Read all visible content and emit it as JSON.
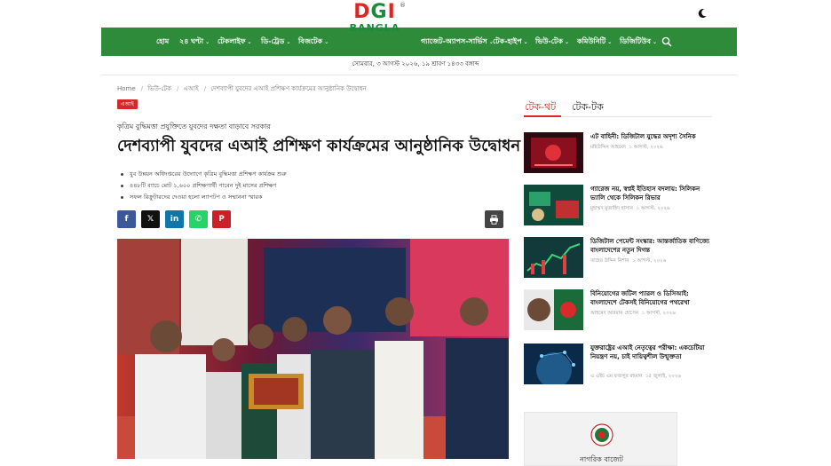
{
  "header": {
    "logo_text": "DGI",
    "logo_sub": "BANGLA",
    "dark_mode_icon": "moon-icon"
  },
  "nav": {
    "items": [
      {
        "label": "হোম",
        "has_dropdown": false
      },
      {
        "label": "২৪ ঘণ্টা",
        "has_dropdown": true
      },
      {
        "label": "টেকলাইফ",
        "has_dropdown": true
      },
      {
        "label": "ডি-ট্রেড",
        "has_dropdown": true
      },
      {
        "label": "বিজটেক",
        "has_dropdown": true
      },
      {
        "label": "গ্যাজেট-অ্যাপস-সার্ভিস",
        "has_dropdown": true
      },
      {
        "label": "টেক-হাইপ",
        "has_dropdown": true
      },
      {
        "label": "ভিউ-টেক",
        "has_dropdown": true
      },
      {
        "label": "কমিউনিটি",
        "has_dropdown": true
      },
      {
        "label": "ডিজিটিউব",
        "has_dropdown": true
      }
    ],
    "search_icon": "search-icon",
    "color": "#2e8b3a"
  },
  "dateline": "সোমবার, ৩ আগস্ট ২০২৬, ১৯ শ্রাবণ ১৪৩৩ বঙ্গাব্দ",
  "breadcrumb": [
    "Home",
    "ভিউ-টেক",
    "এআই",
    "দেশব্যাপী যুবদের এআই প্রশিক্ষণ কার্যক্রমের আনুষ্ঠানিক উদ্বোধন"
  ],
  "article": {
    "category_tag": "এআই",
    "kicker": "কৃত্রিম বুদ্ধিমত্তা প্রযুক্তিতে যুবদের দক্ষতা বাড়াবে সরকার",
    "headline": "দেশব্যাপী যুবদের এআই প্রশিক্ষণ কার্যক্রমের আনুষ্ঠানিক উদ্বোধন",
    "bullets": [
      "যুব উন্নয়ন অধিদপ্তরের উদ্যোগে কৃত্রিম বুদ্ধিমত্তা প্রশিক্ষণ কার্যক্রম শুরু",
      "৪৪৮টি ব্যাচে মোট ১,৬০০ প্রশিক্ষণার্থী পাবেন দুই মাসের প্রশিক্ষণ",
      "সফল রিক্রুটারদের দেওয়া হলো ল্যাপটপ ও সম্মাননা স্মারক"
    ],
    "share": [
      {
        "name": "facebook",
        "glyph": "f",
        "color": "#3b5998"
      },
      {
        "name": "x",
        "glyph": "𝕏",
        "color": "#111111"
      },
      {
        "name": "linkedin",
        "glyph": "in",
        "color": "#0e76a8"
      },
      {
        "name": "whatsapp",
        "glyph": "✆",
        "color": "#25d366"
      },
      {
        "name": "pinterest",
        "glyph": "P",
        "color": "#cb2027"
      }
    ],
    "print_icon": "printer-icon",
    "hero_image": "photo-award-ceremony"
  },
  "sidebar": {
    "tabs": [
      {
        "label": "টেক-থট",
        "active": true
      },
      {
        "label": "টেক-টক",
        "active": false
      }
    ],
    "items": [
      {
        "title": "এট বাহিনী: ডিজিটাল যুদ্ধের অদৃশ্য সৈনিক",
        "author": "মহিউদ্দিন আহমেদ",
        "date": "১ আগস্ট, ২০২৬",
        "thumb": "red-digital"
      },
      {
        "title": "গ্যারেজ নয়, স্বপ্নই ইতিহাস বদলায়: সিলিকন ভ্যালি থেকে সিলিকন রিভার",
        "author": "মুহাম্মদ মুজাহিদ হাসান",
        "date": "১ আগস্ট, ২০২৬",
        "thumb": "green-circuit"
      },
      {
        "title": "ডিজিটাল পেমেন্ট সংস্কার: আন্তর্জাতিক বাণিজ্যে বাংলাদেশের নতুন দিগন্ত",
        "author": "তাহের উদ্দিন নিশান",
        "date": "১ আগস্ট, ২০২৬",
        "thumb": "payment-chart"
      },
      {
        "title": "বিনিয়োগের জটিল প্যারল ও ডিসিআই: বাংলাদেশে টেকসই বিনিয়োগের পথরেখা",
        "author": "আহমেদ আরমান হোসেন",
        "date": "১ আগস্ট, ২০২৬",
        "thumb": "bd-map"
      },
      {
        "title": "যুক্তরাষ্ট্রের এআই নেতৃত্বের পরীক্ষা: একচেটিয়া নিয়ন্ত্রণ নয়, চাই দায়িত্বশীল উন্মুক্ততা",
        "author": "এ এইচ এম ফজলুর রহমান",
        "date": "১৫ জুলাই, ২০২৬",
        "thumb": "blue-network"
      }
    ]
  },
  "ad": {
    "text": "নাগরিক বাজেট"
  }
}
